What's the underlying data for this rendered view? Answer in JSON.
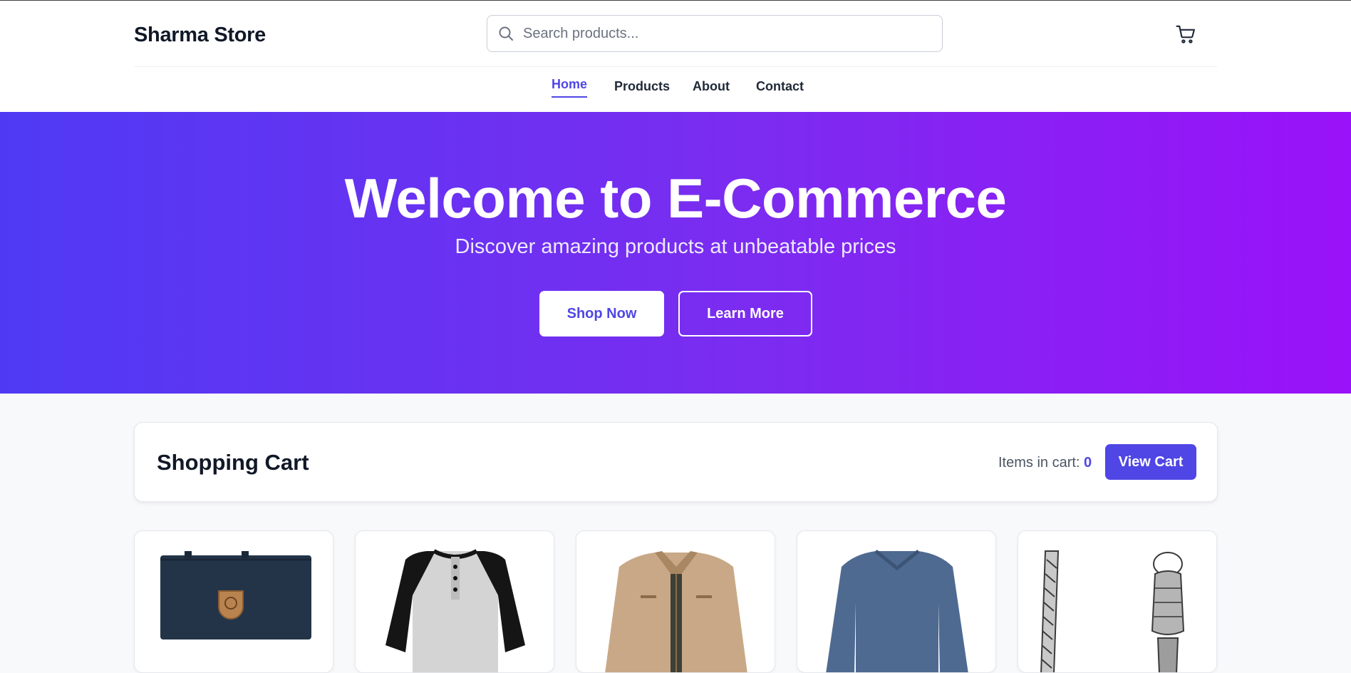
{
  "header": {
    "brand": "Sharma Store",
    "search": {
      "placeholder": "Search products...",
      "value": ""
    },
    "cart_icon": "shopping-cart-icon"
  },
  "nav": {
    "items": [
      {
        "label": "Home",
        "active": true
      },
      {
        "label": "Products",
        "active": false
      },
      {
        "label": "About",
        "active": false
      },
      {
        "label": "Contact",
        "active": false
      }
    ]
  },
  "hero": {
    "title": "Welcome to E-Commerce",
    "subtitle": "Discover amazing products at unbeatable prices",
    "primary_button": "Shop Now",
    "secondary_button": "Learn More"
  },
  "cart": {
    "title": "Shopping Cart",
    "items_label": "Items in cart:",
    "items_count": "0",
    "view_button": "View Cart"
  },
  "products": [
    {
      "image": "navy-backpack"
    },
    {
      "image": "raglan-henley-shirt"
    },
    {
      "image": "tan-jacket"
    },
    {
      "image": "blue-long-sleeve-tee"
    },
    {
      "image": "silver-chain-bracelet"
    }
  ],
  "colors": {
    "accent": "#4f46e5",
    "hero_gradient_start": "#4f3af4",
    "hero_gradient_end": "#9a12f9"
  }
}
